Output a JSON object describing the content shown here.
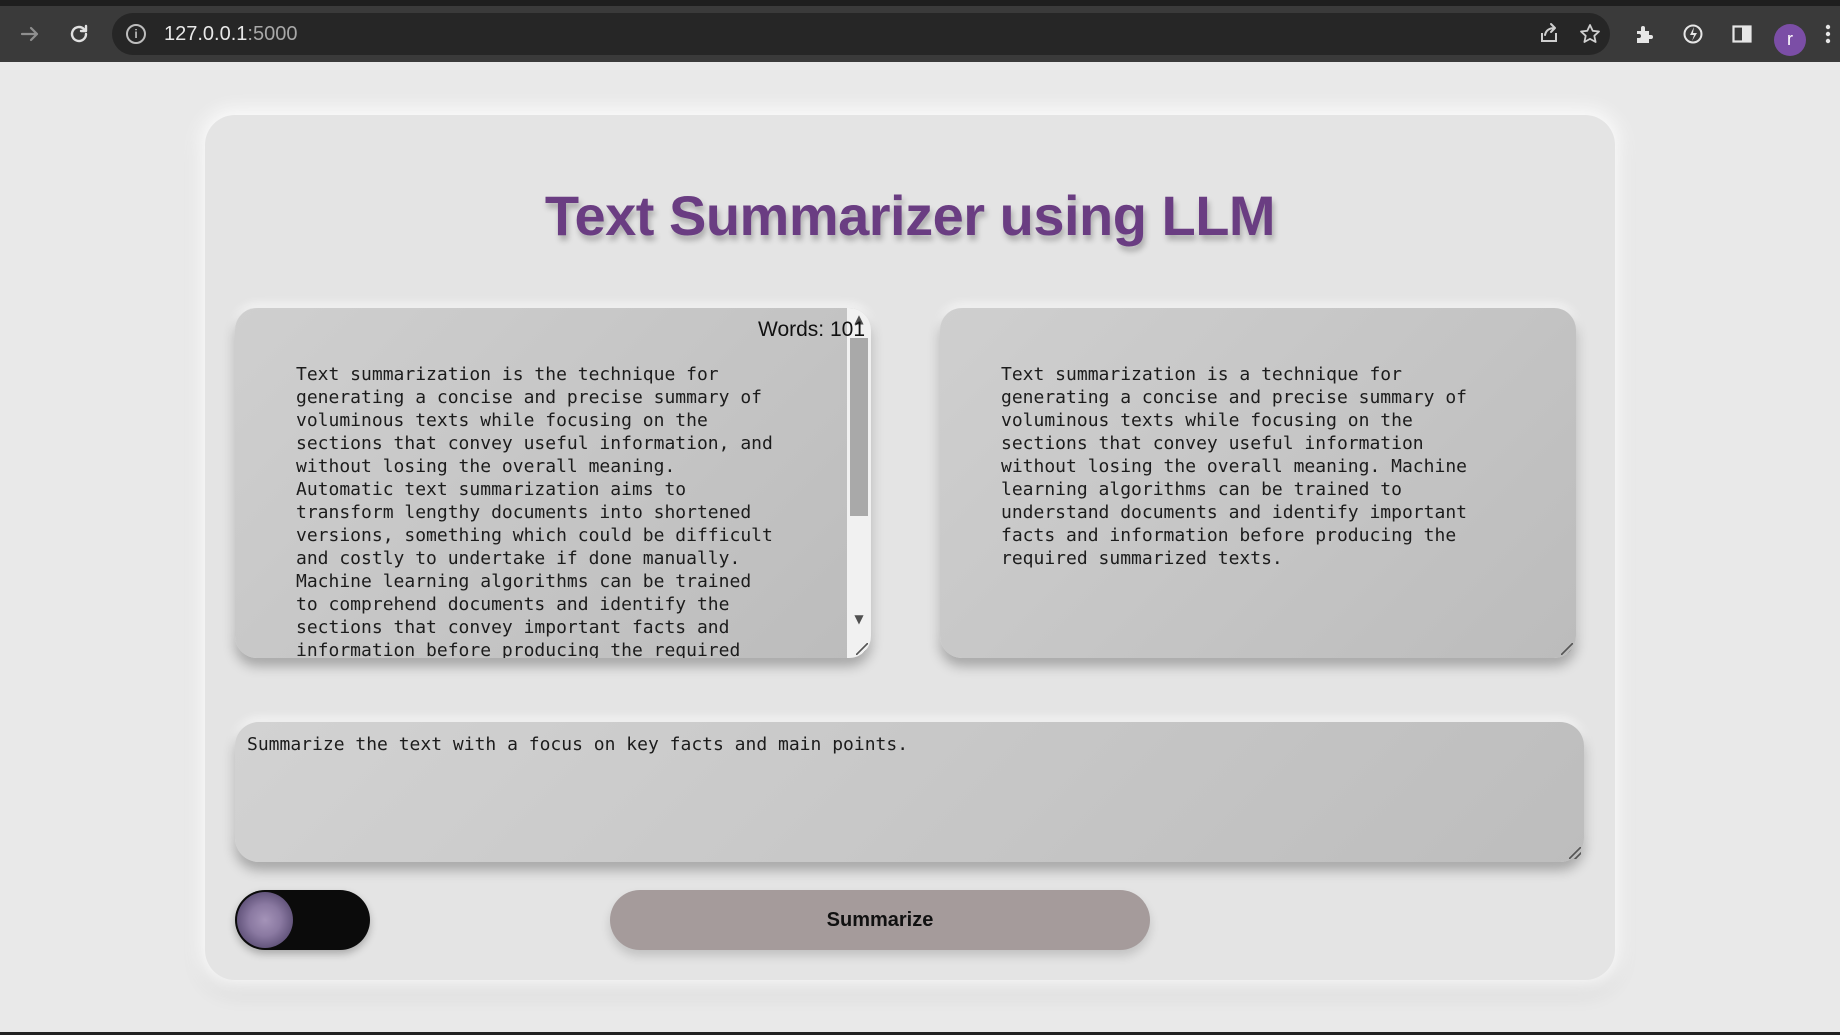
{
  "browser": {
    "url_host": "127.0.0.1",
    "url_port": ":5000",
    "icons": {
      "forward": "forward-arrow-icon",
      "reload": "reload-icon",
      "info": "info-icon",
      "share": "share-icon",
      "bookmark": "star-icon",
      "extensions": "puzzle-icon",
      "sync": "sync-icon",
      "side_panel": "side-panel-icon",
      "menu": "kebab-menu-icon"
    },
    "profile_initial": "r",
    "profile_color": "#7b4ea6"
  },
  "app": {
    "title": "Text Summarizer using LLM",
    "title_color": "#6a3d82",
    "input": {
      "word_count": "Words: 101",
      "text": "Text summarization is the technique for\ngenerating a concise and precise summary of\nvoluminous texts while focusing on the\nsections that convey useful information, and\nwithout losing the overall meaning.\nAutomatic text summarization aims to\ntransform lengthy documents into shortened\nversions, something which could be difficult\nand costly to undertake if done manually.\nMachine learning algorithms can be trained\nto comprehend documents and identify the\nsections that convey important facts and\ninformation before producing the required"
    },
    "output": {
      "text": "Text summarization is a technique for\ngenerating a concise and precise summary of\nvoluminous texts while focusing on the\nsections that convey useful information\nwithout losing the overall meaning. Machine\nlearning algorithms can be trained to\nunderstand documents and identify important\nfacts and information before producing the\nrequired summarized texts."
    },
    "prompt": {
      "text": "Summarize the text with a focus on key facts and main points."
    },
    "toggle_state": "off",
    "summarize_label": "Summarize",
    "button_color": "#a59b9b"
  }
}
